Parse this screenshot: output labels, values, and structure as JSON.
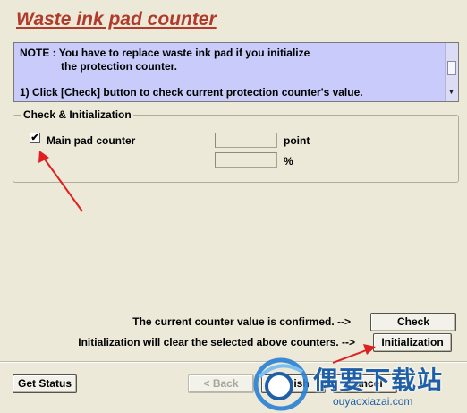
{
  "window": {
    "title": "Waste ink pad counter"
  },
  "note": {
    "line1": "NOTE : You have to replace waste ink pad if you initialize",
    "line2": "the protection counter.",
    "line3": "1) Click [Check] button to check current protection counter's value."
  },
  "group": {
    "label": "Check & Initialization",
    "checkbox_mark": "✔",
    "checkbox_checked": true,
    "checkbox_label": "Main pad counter",
    "unit_point": "point",
    "unit_percent": "%",
    "point_value": "",
    "percent_value": ""
  },
  "actions": {
    "confirm_text": "The current counter value is confirmed. -->",
    "check_label": "Check",
    "init_text": "Initialization will clear the selected above counters. -->",
    "init_label": "Initialization"
  },
  "footer": {
    "get_status_label": "Get Status",
    "back_label": "< Back",
    "finish_label": "Finish",
    "cancel_label": "Cancel"
  },
  "watermark": {
    "cn_text": "偶要下载站",
    "en_text": "ouyaoxiazai.com"
  },
  "colors": {
    "title": "#b23a2a",
    "note_bg": "#c9ccfb",
    "window_bg": "#ece9d8",
    "annotation_arrow": "#e02020",
    "watermark": "#1f5fa8"
  }
}
